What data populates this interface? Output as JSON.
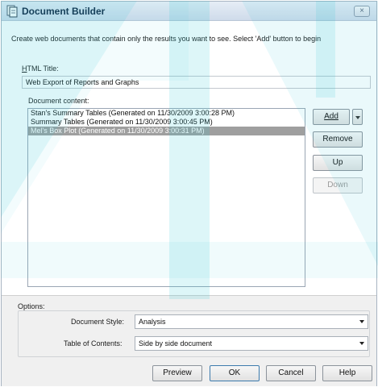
{
  "window": {
    "title": "Document Builder",
    "close_label": "×"
  },
  "description": "Create web documents that contain only the results you want to see.  Select 'Add' button to begin",
  "html_title": {
    "label": "HTML Title:",
    "value": "Web Export of Reports and Graphs"
  },
  "document_content": {
    "label": "Document content:",
    "items": [
      "Stan's Summary Tables (Generated on 11/30/2009 3:00:28 PM)",
      "Summary Tables (Generated on 11/30/2009 3:00:45 PM)",
      "Mel's Box Plot (Generated on 11/30/2009 3:00:31 PM)"
    ],
    "selected_index": 2
  },
  "side_buttons": {
    "add": "Add",
    "remove": "Remove",
    "up": "Up",
    "down": "Down"
  },
  "options": {
    "label": "Options:",
    "document_style_label": "Document Style:",
    "document_style_value": "Analysis",
    "toc_label": "Table of Contents:",
    "toc_value": "Side by side document"
  },
  "footer_buttons": {
    "preview": "Preview",
    "ok": "OK",
    "cancel": "Cancel",
    "help": "Help"
  },
  "colors": {
    "watermark": "#2ec4d6",
    "selection": "#9f9f9f"
  }
}
